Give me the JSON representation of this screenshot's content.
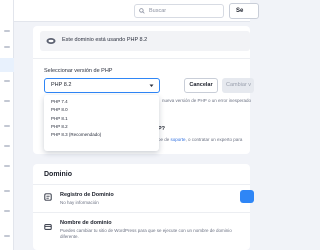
{
  "topbar": {
    "search_placeholder": "Buscar",
    "button_label": "Se"
  },
  "php_card": {
    "info_text": "Este dominio está usando PHP 8.2",
    "select_label": "Seleccionar versión de PHP",
    "selected_value": "PHP 8.2",
    "cancel_label": "Cancelar",
    "change_label": "Cambiar v",
    "note_text": "nueva versión de PHP o un error inesperado",
    "dropdown_options": [
      "PHP 7.4",
      "PHP 8.0",
      "PHP 8.1",
      "PHP 8.2",
      "PHP 8.3 (Recomendado)"
    ]
  },
  "partial_card": {
    "question_text": "P?",
    "help_prefix": "pe de ",
    "help_link": "soporte",
    "help_suffix": ", o contratar un experto para"
  },
  "domain_section": {
    "title": "Dominio",
    "registro_title": "Registro de Dominio",
    "registro_sub": "No hay información",
    "nombre_title": "Nombre de dominio",
    "nombre_sub_1": "Puedes cambiar tu sitio de WordPress para que se ejecute con un nombre de dominio",
    "nombre_sub_2": "diferente."
  },
  "colors": {
    "accent": "#2f86f6",
    "background": "#f1f3f8"
  }
}
